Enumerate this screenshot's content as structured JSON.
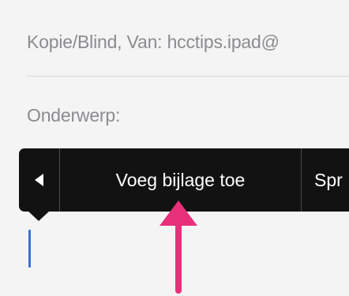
{
  "header": {
    "cc_label": "Kopie/Blind, Van:",
    "cc_value": "hcctips.ipad@",
    "subject_label": "Onderwerp:"
  },
  "context_menu": {
    "items": [
      {
        "label": "Voeg bijlage toe"
      },
      {
        "label": "Spr"
      }
    ],
    "back_icon": "triangle-left-icon"
  },
  "colors": {
    "menu_background": "#121212",
    "annotation_arrow": "#e8307a",
    "text_cursor": "#3b6fd8"
  }
}
